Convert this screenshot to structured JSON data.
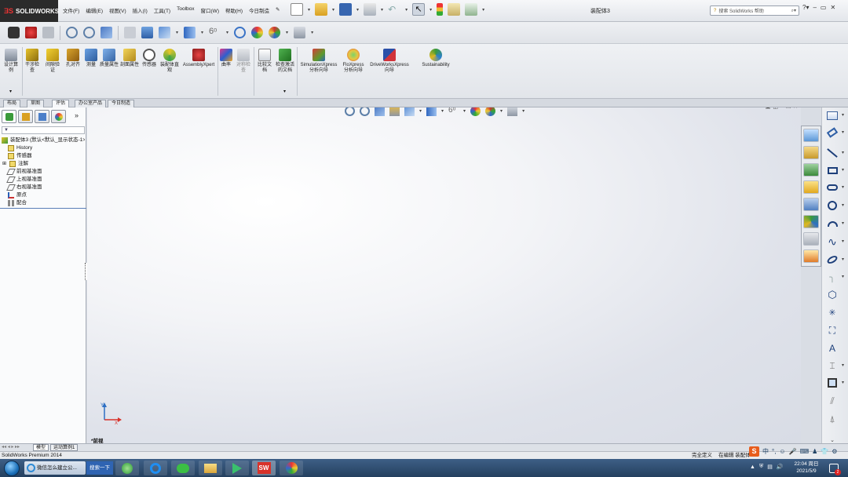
{
  "app": {
    "brand": "SOLIDWORKS",
    "document_title": "装配体3",
    "search_placeholder": "搜索 SolidWorks 帮助"
  },
  "menu": [
    "文件(F)",
    "编辑(E)",
    "视图(V)",
    "插入(I)",
    "工具(T)",
    "Toolbox",
    "窗口(W)",
    "帮助(H)",
    "今日制造"
  ],
  "command_manager": {
    "buttons": [
      {
        "label": "设计算例",
        "icon": "design-study-icon"
      },
      {
        "label": "干涉检查",
        "icon": "interference-check-icon"
      },
      {
        "label": "间隙验证",
        "icon": "clearance-verify-icon"
      },
      {
        "label": "孔对齐",
        "icon": "hole-align-icon"
      },
      {
        "label": "测量",
        "icon": "measure-icon"
      },
      {
        "label": "质量属性",
        "icon": "mass-properties-icon"
      },
      {
        "label": "剖面属性",
        "icon": "section-properties-icon"
      },
      {
        "label": "传感器",
        "icon": "sensor-icon"
      },
      {
        "label": "装配体直观",
        "icon": "assembly-visualization-icon"
      },
      {
        "label": "AssemblyXpert",
        "icon": "assemblyxpert-icon"
      },
      {
        "label": "曲率",
        "icon": "curvature-icon"
      },
      {
        "label": "对称检查",
        "icon": "symmetry-check-icon"
      },
      {
        "label": "比较文档",
        "icon": "compare-documents-icon"
      },
      {
        "label": "检查激活的文档",
        "icon": "check-active-document-icon"
      },
      {
        "label": "SimulationXpress 分析向导",
        "icon": "simulationxpress-icon"
      },
      {
        "label": "FloXpress 分析向导",
        "icon": "floxpress-icon"
      },
      {
        "label": "DriveWorksXpress 向导",
        "icon": "driveworksxpress-icon"
      },
      {
        "label": "Sustainability",
        "icon": "sustainability-icon"
      }
    ]
  },
  "cm_tabs": [
    "布局",
    "草图",
    "评估",
    "办公室产品",
    "今日制造"
  ],
  "cm_tab_active": "评估",
  "feature_tree": {
    "root": "装配体3 (默认<默认_显示状态-1>)",
    "items": [
      "History",
      "传感器",
      "注解",
      "前视基准面",
      "上视基准面",
      "右视基准面",
      "原点",
      "配合"
    ]
  },
  "graphics": {
    "view_label": "*前视",
    "axis_x": "X",
    "axis_y": "Y"
  },
  "model_tabs": [
    "模型",
    "运动算例1"
  ],
  "status": {
    "product": "SolidWorks Premium 2014",
    "right_1": "完全定义",
    "right_2": "在编辑 装配体"
  },
  "taskbar": {
    "ie_label": "微信怎么建立公...",
    "search_label": "搜索一下",
    "ime_label": "中",
    "time": "22:04 周日",
    "date": "2021/5/9",
    "notification_count": "2"
  },
  "colors": {
    "accent_red": "#d8322a",
    "accent_blue": "#2d6fc4",
    "accent_green": "#3a9a3a",
    "accent_yellow": "#e6b820"
  }
}
